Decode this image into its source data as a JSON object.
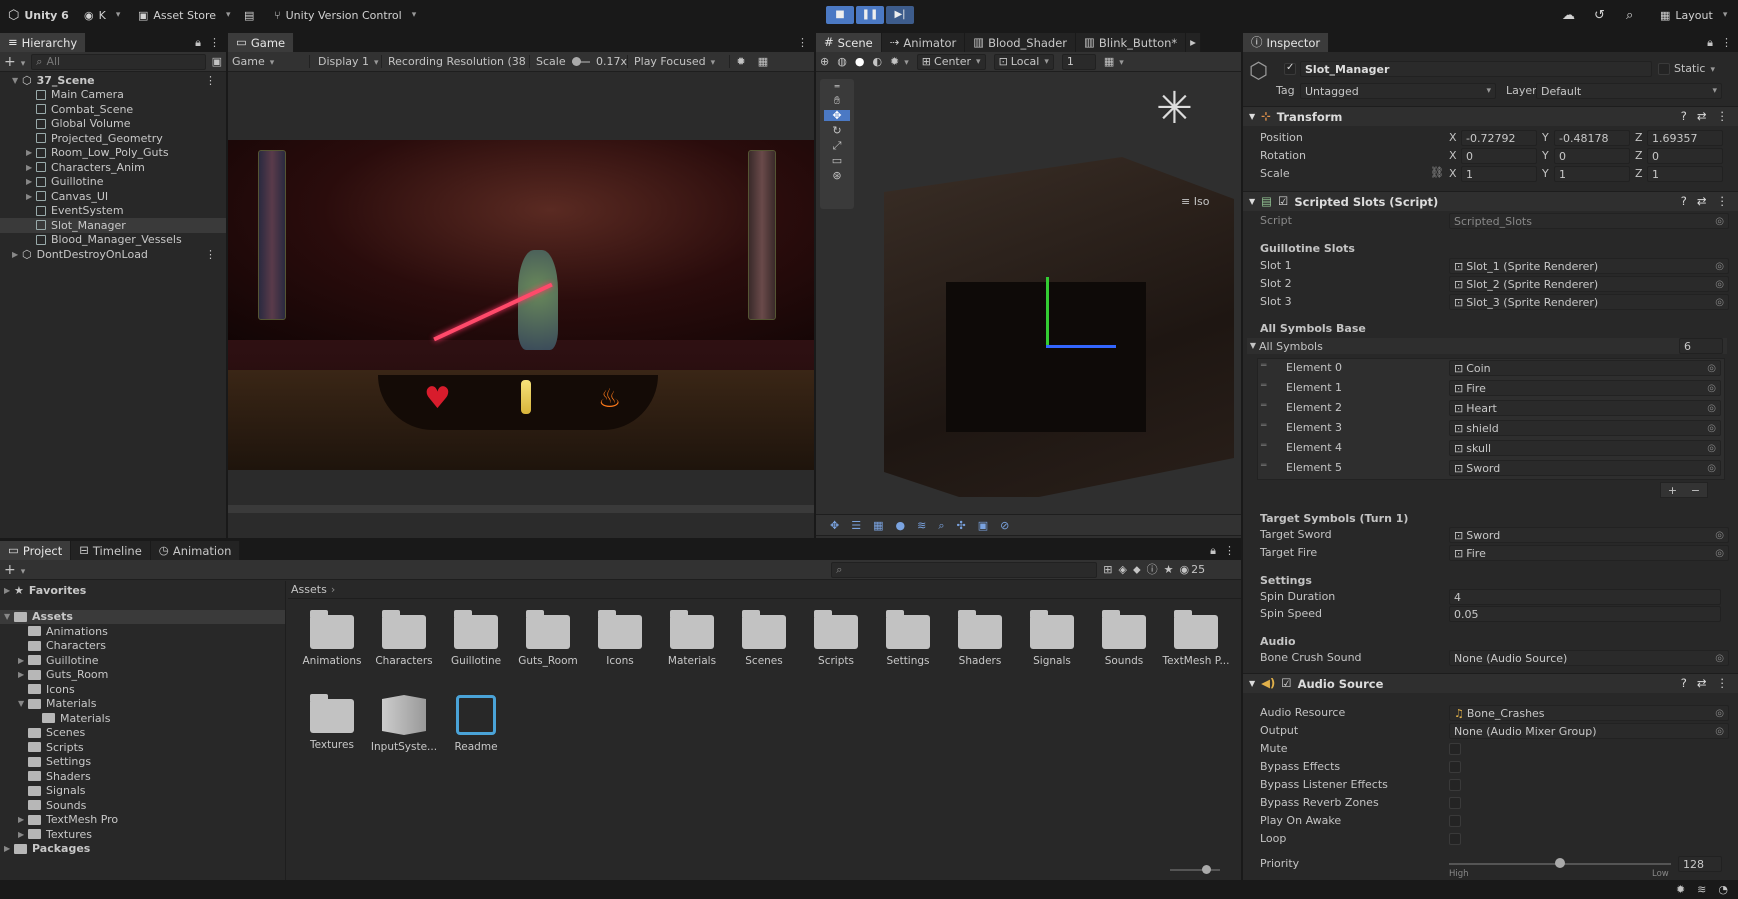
{
  "toolbar": {
    "app_title": "Unity 6",
    "account": "K",
    "asset_store": "Asset Store",
    "version_control": "Unity Version Control",
    "layout": "Layout"
  },
  "hierarchy": {
    "tab": "Hierarchy",
    "search_placeholder": "All",
    "items": [
      {
        "label": "37_Scene",
        "depth": 0,
        "kind": "scene"
      },
      {
        "label": "Main Camera",
        "depth": 1,
        "kind": "obj"
      },
      {
        "label": "Combat_Scene",
        "depth": 1,
        "kind": "obj"
      },
      {
        "label": "Global Volume",
        "depth": 1,
        "kind": "obj"
      },
      {
        "label": "Projected_Geometry",
        "depth": 1,
        "kind": "obj"
      },
      {
        "label": "Room_Low_Poly_Guts",
        "depth": 1,
        "kind": "obj",
        "expand": true
      },
      {
        "label": "Characters_Anim",
        "depth": 1,
        "kind": "obj",
        "expand": true
      },
      {
        "label": "Guillotine",
        "depth": 1,
        "kind": "obj",
        "expand": true
      },
      {
        "label": "Canvas_UI",
        "depth": 1,
        "kind": "obj",
        "expand": true
      },
      {
        "label": "EventSystem",
        "depth": 1,
        "kind": "obj"
      },
      {
        "label": "Slot_Manager",
        "depth": 1,
        "kind": "obj",
        "selected": true
      },
      {
        "label": "Blood_Manager_Vessels",
        "depth": 1,
        "kind": "obj"
      },
      {
        "label": "DontDestroyOnLoad",
        "depth": 0,
        "kind": "scene"
      }
    ]
  },
  "game": {
    "tab": "Game",
    "mode": "Game",
    "display": "Display 1",
    "resolution": "Recording Resolution (38",
    "scale_label": "Scale",
    "scale_value": "0.17x",
    "play_focused": "Play Focused"
  },
  "scene": {
    "tabs": [
      "Scene",
      "Animator",
      "Blood_Shader",
      "Blink_Button*"
    ],
    "pivot": "Center",
    "space": "Local",
    "snap": "1",
    "projection": "Iso"
  },
  "inspector": {
    "tab": "Inspector",
    "object_name": "Slot_Manager",
    "static_label": "Static",
    "tag_label": "Tag",
    "tag_value": "Untagged",
    "layer_label": "Layer",
    "layer_value": "Default",
    "transform": {
      "title": "Transform",
      "position_label": "Position",
      "px": "-0.72792",
      "py": "-0.48178",
      "pz": "1.69357",
      "rotation_label": "Rotation",
      "rx": "0",
      "ry": "0",
      "rz": "0",
      "scale_label": "Scale",
      "sx": "1",
      "sy": "1",
      "sz": "1"
    },
    "script": {
      "title": "Scripted Slots (Script)",
      "script_label": "Script",
      "script_value": "Scripted_Slots",
      "guillotine_header": "Guillotine Slots",
      "slots": [
        {
          "label": "Slot 1",
          "value": "Slot_1 (Sprite Renderer)"
        },
        {
          "label": "Slot 2",
          "value": "Slot_2 (Sprite Renderer)"
        },
        {
          "label": "Slot 3",
          "value": "Slot_3 (Sprite Renderer)"
        }
      ],
      "symbols_base_header": "All Symbols Base",
      "all_symbols_label": "All Symbols",
      "all_symbols_count": "6",
      "elements": [
        {
          "label": "Element 0",
          "value": "Coin"
        },
        {
          "label": "Element 1",
          "value": "Fire"
        },
        {
          "label": "Element 2",
          "value": "Heart"
        },
        {
          "label": "Element 3",
          "value": "shield"
        },
        {
          "label": "Element 4",
          "value": "skull"
        },
        {
          "label": "Element 5",
          "value": "Sword"
        }
      ],
      "target_header": "Target Symbols (Turn 1)",
      "target_sword_label": "Target Sword",
      "target_sword_value": "Sword",
      "target_fire_label": "Target Fire",
      "target_fire_value": "Fire",
      "settings_header": "Settings",
      "spin_duration_label": "Spin Duration",
      "spin_duration_value": "4",
      "spin_speed_label": "Spin Speed",
      "spin_speed_value": "0.05",
      "audio_header": "Audio",
      "bone_crush_label": "Bone Crush Sound",
      "bone_crush_value": "None (Audio Source)"
    },
    "audio_source": {
      "title": "Audio Source",
      "resource_label": "Audio Resource",
      "resource_value": "Bone_Crashes",
      "output_label": "Output",
      "output_value": "None (Audio Mixer Group)",
      "toggles": [
        "Mute",
        "Bypass Effects",
        "Bypass Listener Effects",
        "Bypass Reverb Zones",
        "Play On Awake",
        "Loop"
      ],
      "priority_label": "Priority",
      "priority_value": "128",
      "priority_fraction": 0.5,
      "priority_high": "High",
      "priority_low": "Low"
    }
  },
  "project": {
    "tabs": [
      "Project",
      "Timeline",
      "Animation"
    ],
    "hidden_count": "25",
    "favorites": "Favorites",
    "assets_root": "Assets",
    "breadcrumb": "Assets",
    "tree": [
      {
        "label": "Animations",
        "depth": 1
      },
      {
        "label": "Characters",
        "depth": 1
      },
      {
        "label": "Guillotine",
        "depth": 1,
        "expand": true
      },
      {
        "label": "Guts_Room",
        "depth": 1,
        "expand": true
      },
      {
        "label": "Icons",
        "depth": 1
      },
      {
        "label": "Materials",
        "depth": 1,
        "open": true
      },
      {
        "label": "Materials",
        "depth": 2
      },
      {
        "label": "Scenes",
        "depth": 1
      },
      {
        "label": "Scripts",
        "depth": 1
      },
      {
        "label": "Settings",
        "depth": 1
      },
      {
        "label": "Shaders",
        "depth": 1
      },
      {
        "label": "Signals",
        "depth": 1
      },
      {
        "label": "Sounds",
        "depth": 1
      },
      {
        "label": "TextMesh Pro",
        "depth": 1,
        "expand": true
      },
      {
        "label": "Textures",
        "depth": 1,
        "expand": true
      }
    ],
    "packages": "Packages",
    "grid": [
      "Animations",
      "Characters",
      "Guillotine",
      "Guts_Room",
      "Icons",
      "Materials",
      "Scenes",
      "Scripts",
      "Settings",
      "Shaders",
      "Signals",
      "Sounds",
      "TextMesh P..."
    ],
    "grid2": [
      {
        "label": "Textures",
        "kind": "folder"
      },
      {
        "label": "InputSyste...",
        "kind": "input"
      },
      {
        "label": "Readme",
        "kind": "readme"
      }
    ]
  },
  "colors": {
    "accent": "#4b79c4",
    "panel": "#282828",
    "header": "#191919"
  }
}
